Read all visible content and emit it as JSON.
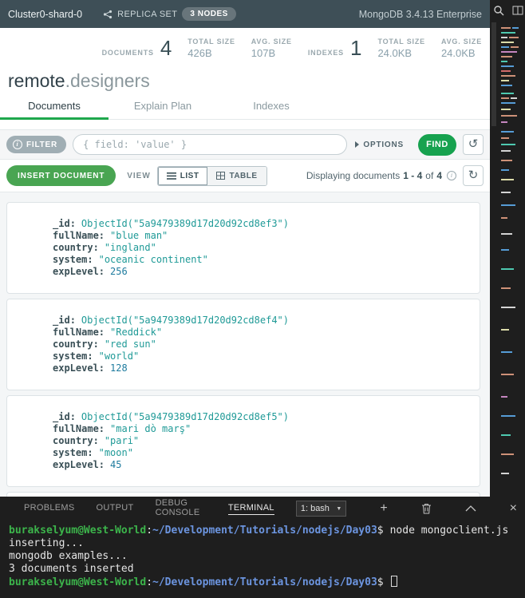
{
  "topbar": {
    "cluster_name": "Cluster0-shard-0",
    "replica_set_label": "REPLICA SET",
    "nodes_badge": "3 NODES",
    "version": "MongoDB 3.4.13 Enterprise"
  },
  "stats": {
    "documents_label": "DOCUMENTS",
    "documents_count": "4",
    "documents_total_size_label": "TOTAL SIZE",
    "documents_total_size": "426B",
    "documents_avg_size_label": "AVG. SIZE",
    "documents_avg_size": "107B",
    "indexes_label": "INDEXES",
    "indexes_count": "1",
    "indexes_total_size_label": "TOTAL SIZE",
    "indexes_total_size": "24.0KB",
    "indexes_avg_size_label": "AVG. SIZE",
    "indexes_avg_size": "24.0KB"
  },
  "namespace": {
    "database": "remote",
    "collection": ".designers"
  },
  "tabs": {
    "documents": "Documents",
    "explain_plan": "Explain Plan",
    "indexes": "Indexes"
  },
  "filter_bar": {
    "filter_label": "FILTER",
    "placeholder": "{ field: 'value' }",
    "options_label": "OPTIONS",
    "find_label": "FIND"
  },
  "toolbar": {
    "insert_label": "INSERT DOCUMENT",
    "view_label": "VIEW",
    "list_label": "LIST",
    "table_label": "TABLE",
    "displaying_prefix": "Displaying documents",
    "range": "1 - 4",
    "of_word": "of",
    "total": "4"
  },
  "documents": [
    {
      "fields": [
        {
          "key": "_id",
          "value": "ObjectId(\"5a9479389d17d20d92cd8ef3\")"
        },
        {
          "key": "fullName",
          "value": "\"blue man\""
        },
        {
          "key": "country",
          "value": "\"ingland\""
        },
        {
          "key": "system",
          "value": "\"oceanic continent\""
        },
        {
          "key": "expLevel",
          "value": "256"
        }
      ]
    },
    {
      "fields": [
        {
          "key": "_id",
          "value": "ObjectId(\"5a9479389d17d20d92cd8ef4\")"
        },
        {
          "key": "fullName",
          "value": "\"Reddick\""
        },
        {
          "key": "country",
          "value": "\"red sun\""
        },
        {
          "key": "system",
          "value": "\"world\""
        },
        {
          "key": "expLevel",
          "value": "128"
        }
      ]
    },
    {
      "fields": [
        {
          "key": "_id",
          "value": "ObjectId(\"5a9479389d17d20d92cd8ef5\")"
        },
        {
          "key": "fullName",
          "value": "\"mari dò marş\""
        },
        {
          "key": "country",
          "value": "\"pari\""
        },
        {
          "key": "system",
          "value": "\"moon\""
        },
        {
          "key": "expLevel",
          "value": "45"
        }
      ]
    }
  ],
  "terminal_panel": {
    "tabs": {
      "problems": "PROBLEMS",
      "output": "OUTPUT",
      "debug_console": "DEBUG CONSOLE",
      "terminal": "TERMINAL"
    },
    "shell_selector": "1: bash",
    "prompt_user": "burakselyum@West-World",
    "prompt_separator": ":",
    "prompt_path": "~/Development/Tutorials/nodejs/Day03",
    "prompt_symbol": "$",
    "command": "node mongoclient.js",
    "output_lines": [
      "inserting...",
      "mongodb examples...",
      "3 documents inserted"
    ]
  },
  "icons": {
    "info": "i",
    "history": "↺",
    "refresh": "↻",
    "caret_down": "▼",
    "plus": "+",
    "close": "×"
  },
  "colors": {
    "compass_topbar": "#3e4f57",
    "compass_green": "#17a24f",
    "insert_green": "#49a552",
    "string_value": "#1f9a97",
    "number_value": "#1e7b9e",
    "terminal_prompt_green": "#3cb44b",
    "terminal_path_blue": "#6c95e0"
  }
}
